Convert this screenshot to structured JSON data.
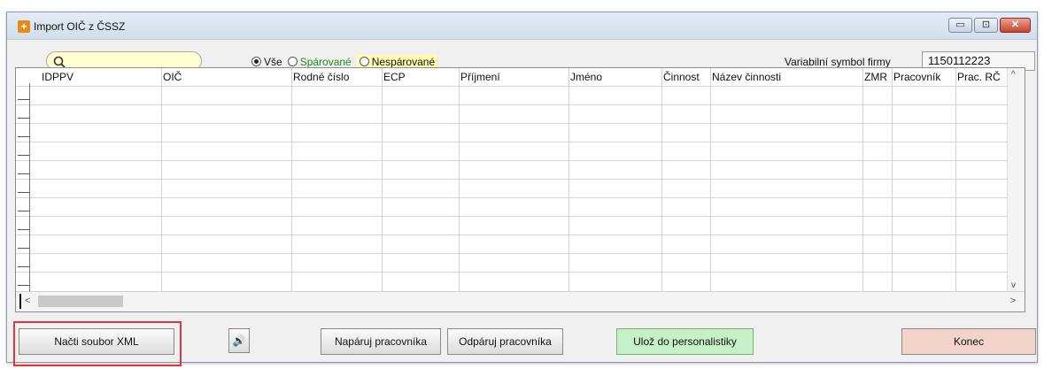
{
  "window": {
    "title": "Import OIČ z ČSSZ",
    "controls": {
      "minimize": "▭",
      "maximize": "⊡",
      "close": "✕"
    }
  },
  "filter": {
    "search_value": "",
    "options": [
      {
        "label": "Vše",
        "selected": true
      },
      {
        "label": "Spárované",
        "selected": false
      },
      {
        "label": "Nespárované",
        "selected": false
      }
    ],
    "variable_symbol_label": "Variabilní symbol firmy",
    "variable_symbol_value": "1150112223"
  },
  "table": {
    "columns": [
      "IDPPV",
      "OIČ",
      "Rodné číslo",
      "ECP",
      "Příjmení",
      "Jméno",
      "Činnost",
      "Název činnosti",
      "ZMR",
      "Pracovník",
      "Prac. RČ"
    ],
    "rows": []
  },
  "scroll": {
    "up": "^",
    "down": "v",
    "left": "<",
    "right": ">"
  },
  "buttons": {
    "load_xml": "Načti soubor XML",
    "sound": "🔊",
    "pair": "Napáruj pracovníka",
    "unpair": "Odpáruj pracovníka",
    "save_personnel": "Ulož do personalistiky",
    "end": "Konec"
  },
  "colors": {
    "highlight_border": "#e0363a",
    "save_button_bg": "#c6f0c6",
    "end_button_bg": "#f3d3ca",
    "search_bg": "#ffffd0"
  }
}
